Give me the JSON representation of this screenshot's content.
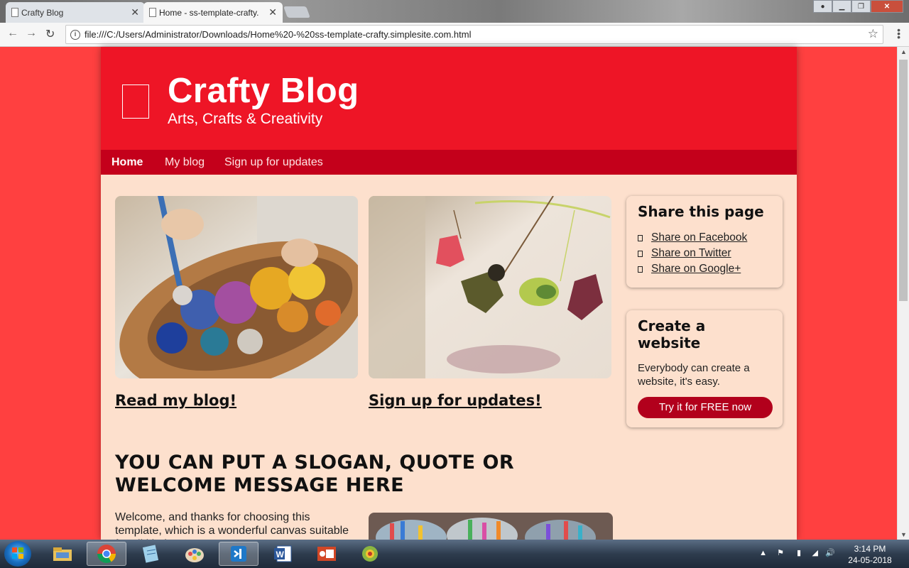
{
  "browser": {
    "tabs": [
      {
        "title": "Crafty Blog",
        "active": false
      },
      {
        "title": "Home - ss-template-crafty.simplesite.com",
        "active": true
      }
    ],
    "url": "file:///C:/Users/Administrator/Downloads/Home%20-%20ss-template-crafty.simplesite.com.html"
  },
  "site": {
    "title": "Crafty Blog",
    "subtitle": "Arts, Crafts & Creativity",
    "nav": [
      {
        "label": "Home",
        "current": true
      },
      {
        "label": "My blog",
        "current": false
      },
      {
        "label": "Sign up for updates",
        "current": false
      }
    ],
    "features": [
      {
        "link": "Read my blog!",
        "image": "paint-palette-photo"
      },
      {
        "link": "Sign up for updates!",
        "image": "crochet-mobile-photo"
      }
    ],
    "slogan": "YOU CAN PUT A SLOGAN, QUOTE OR WELCOME MESSAGE HERE",
    "welcome_text": "Welcome, and thanks for choosing this template, which is a wonderful canvas suitable for all kinds",
    "share": {
      "title": "Share this page",
      "items": [
        "Share on Facebook",
        "Share on Twitter",
        "Share on Google+"
      ]
    },
    "create": {
      "title": "Create a website",
      "text": "Everybody can create a website, it's easy.",
      "button": "Try it for FREE now"
    }
  },
  "taskbar": {
    "time": "3:14 PM",
    "date": "24-05-2018",
    "apps": [
      "file-explorer",
      "chrome",
      "notepad",
      "paint",
      "visual-studio-code",
      "word",
      "powerpoint",
      "chameleon-app"
    ]
  },
  "colors": {
    "background": "#ff4040",
    "header": "#ee1526",
    "nav": "#c4001b",
    "content": "#fde0cd",
    "button": "#b2001c"
  }
}
